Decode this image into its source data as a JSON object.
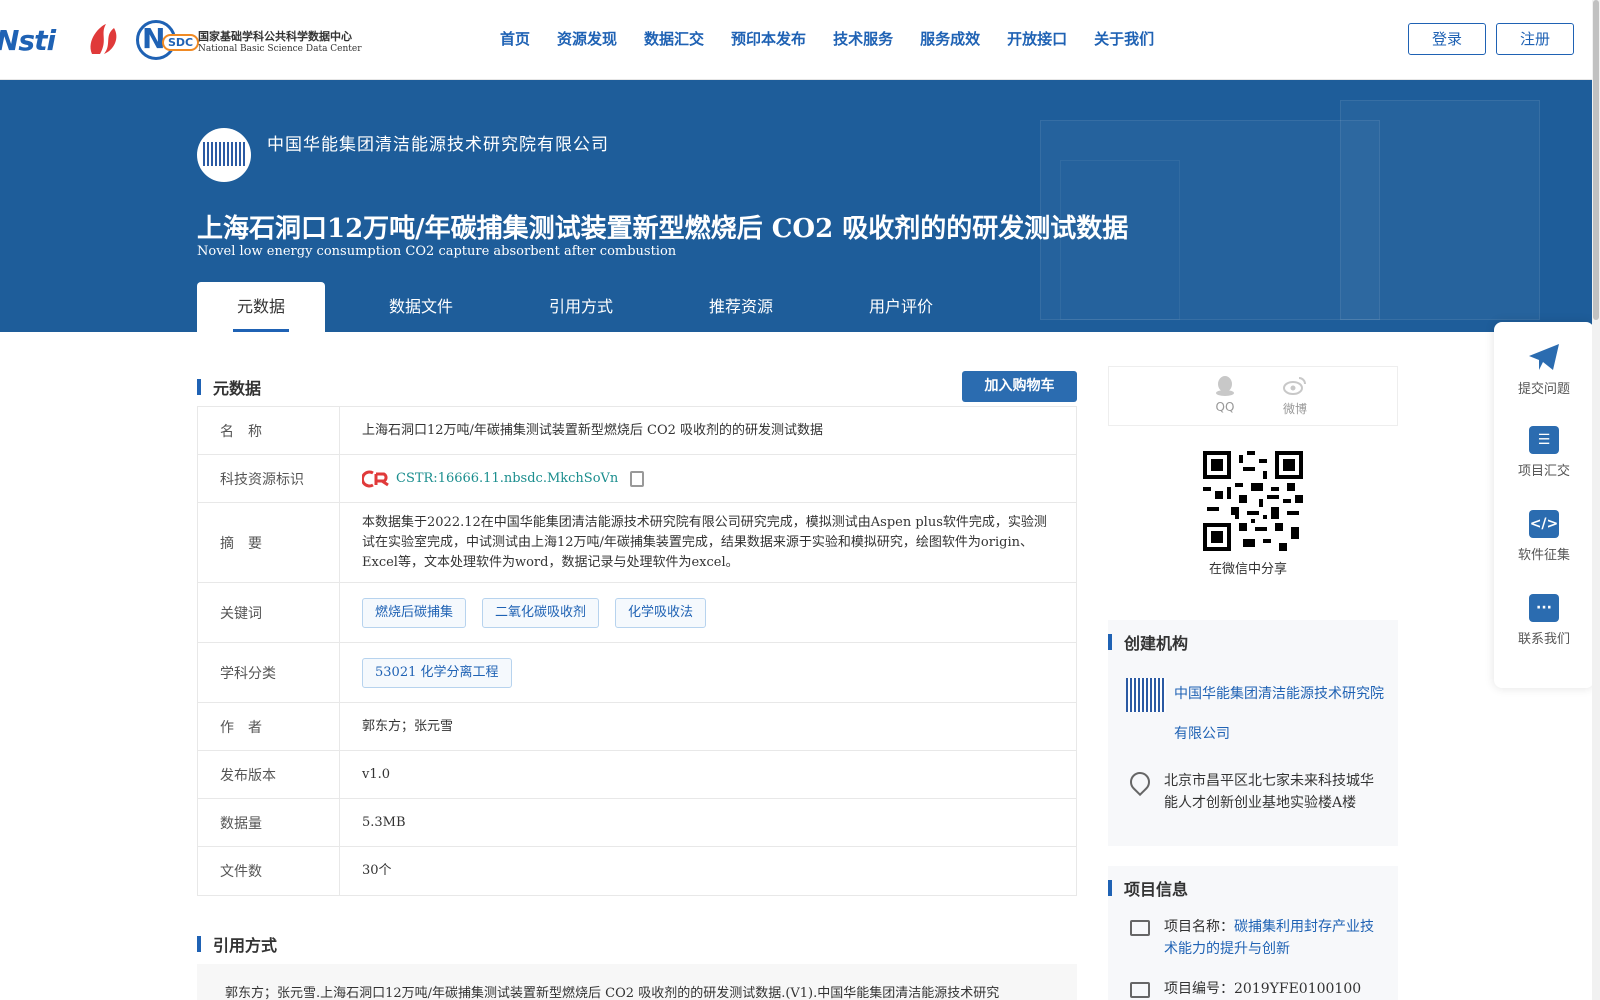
{
  "header": {
    "logo_text": "Nsti",
    "nsdc_badge": "SDC",
    "nsdc_letter": "N",
    "nsdc_cn": "国家基础学科公共科学数据中心",
    "nsdc_en": "National Basic Science Data Center",
    "nav": [
      "首页",
      "资源发现",
      "数据汇交",
      "预印本发布",
      "技术服务",
      "服务成效",
      "开放接口",
      "关于我们"
    ],
    "login": "登录",
    "register": "注册"
  },
  "banner": {
    "org_name": "中国华能集团清洁能源技术研究院有限公司",
    "title_cn": "上海石洞口12万吨/年碳捕集测试装置新型燃烧后 CO2 吸收剂的的研发测试数据",
    "title_en": "Novel low energy consumption CO2 capture absorbent after combustion",
    "tabs": [
      "元数据",
      "数据文件",
      "引用方式",
      "推荐资源",
      "用户评价"
    ]
  },
  "metadata": {
    "section_title": "元数据",
    "cart_button": "加入购物车",
    "rows": {
      "name": {
        "label": "名　称",
        "value": "上海石洞口12万吨/年碳捕集测试装置新型燃烧后 CO2 吸收剂的的研发测试数据"
      },
      "cstr": {
        "label": "科技资源标识",
        "value": "CSTR:16666.11.nbsdc.MkchSoVn"
      },
      "abstract": {
        "label": "摘　要",
        "value": "本数据集于2022.12在中国华能集团清洁能源技术研究院有限公司研究完成，模拟测试由Aspen plus软件完成，实验测试在实验室完成，中试测试由上海12万吨/年碳捕集装置完成，结果数据来源于实验和模拟研究，绘图软件为origin、Excel等，文本处理软件为word，数据记录与处理软件为excel。"
      },
      "keywords": {
        "label": "关键词",
        "values": [
          "燃烧后碳捕集",
          "二氧化碳吸收剂",
          "化学吸收法"
        ]
      },
      "subject": {
        "label": "学科分类",
        "value": "53021 化学分离工程"
      },
      "authors": {
        "label": "作　者",
        "value": "郭东方；张元雪"
      },
      "version": {
        "label": "发布版本",
        "value": "v1.0"
      },
      "size": {
        "label": "数据量",
        "value": "5.3MB"
      },
      "files": {
        "label": "文件数",
        "value": "30个"
      }
    }
  },
  "citation": {
    "section_title": "引用方式",
    "text": "郭东方；张元雪.上海石洞口12万吨/年碳捕集测试装置新型燃烧后 CO2 吸收剂的的研发测试数据.(V1).中国华能集团清洁能源技术研究"
  },
  "sidebar": {
    "share": {
      "qq": "QQ",
      "weibo": "微博"
    },
    "qr_label": "在微信中分享",
    "org_section": {
      "title": "创建机构",
      "org_name": "中国华能集团清洁能源技术研究院有限公司",
      "address": "北京市昌平区北七家未来科技城华能人才创新创业基地实验楼A楼"
    },
    "project_section": {
      "title": "项目信息",
      "name_label": "项目名称：",
      "name_value": "碳捕集利用封存产业技术能力的提升与创新",
      "number_label": "项目编号：",
      "number_value": "2019YFE0100100"
    }
  },
  "float_panel": {
    "items": [
      "提交问题",
      "项目汇交",
      "软件征集",
      "联系我们"
    ]
  }
}
